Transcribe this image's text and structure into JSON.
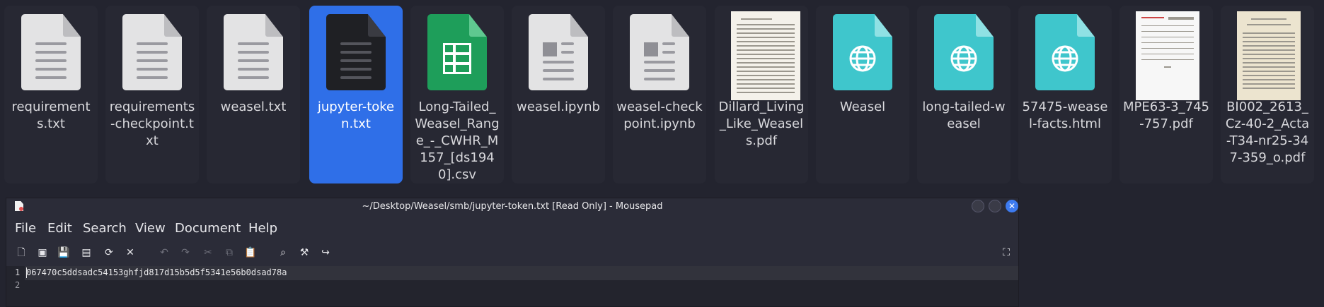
{
  "files": [
    {
      "label": "requirements.txt",
      "icon": "text-file-icon",
      "selected": false
    },
    {
      "label": "requirements-checkpoint.txt",
      "icon": "text-file-icon",
      "selected": false
    },
    {
      "label": "weasel.txt",
      "icon": "text-file-icon",
      "selected": false
    },
    {
      "label": "jupyter-token.txt",
      "icon": "text-file-icon",
      "selected": true
    },
    {
      "label": "Long-Tailed_Weasel_Range_-_CWHR_M157_[ds1940].csv",
      "icon": "spreadsheet-icon",
      "selected": false
    },
    {
      "label": "weasel.ipynb",
      "icon": "notebook-file-icon",
      "selected": false
    },
    {
      "label": "weasel-checkpoint.ipynb",
      "icon": "notebook-file-icon",
      "selected": false
    },
    {
      "label": "Dillard_Living_Like_Weasels.pdf",
      "icon": "pdf-thumbnail",
      "selected": false
    },
    {
      "label": "Weasel",
      "icon": "web-file-icon",
      "selected": false
    },
    {
      "label": "long-tailed-weasel",
      "icon": "web-file-icon",
      "selected": false
    },
    {
      "label": "57475-weasel-facts.html",
      "icon": "web-file-icon",
      "selected": false
    },
    {
      "label": "MPE63-3_745-757.pdf",
      "icon": "pdf-thumbnail",
      "selected": false
    },
    {
      "label": "BI002_2613_Cz-40-2_Acta-T34-nr25-347-359_o.pdf",
      "icon": "pdf-thumbnail",
      "selected": false
    }
  ],
  "window": {
    "title": "~/Desktop/Weasel/smb/jupyter-token.txt [Read Only] - Mousepad",
    "close_glyph": "✕"
  },
  "menu": [
    "File",
    "Edit",
    "Search",
    "View",
    "Document",
    "Help"
  ],
  "toolbar": [
    "new-document-icon",
    "new-window-icon",
    "save-icon",
    "save-as-icon",
    "reload-icon",
    "close-icon",
    "undo-icon",
    "redo-icon",
    "cut-icon",
    "copy-icon",
    "paste-icon",
    "find-icon",
    "find-replace-icon",
    "go-to-line-icon",
    "fullscreen-icon"
  ],
  "editor": {
    "lines": [
      "067470c5ddsadc54153ghfjd817d15b5d5f5341e56b0dsad78a",
      ""
    ],
    "line_numbers": [
      "1",
      "2"
    ]
  },
  "colors": {
    "selection": "#2f6fe8",
    "background": "#23242f",
    "close_button": "#3d7bf0"
  }
}
